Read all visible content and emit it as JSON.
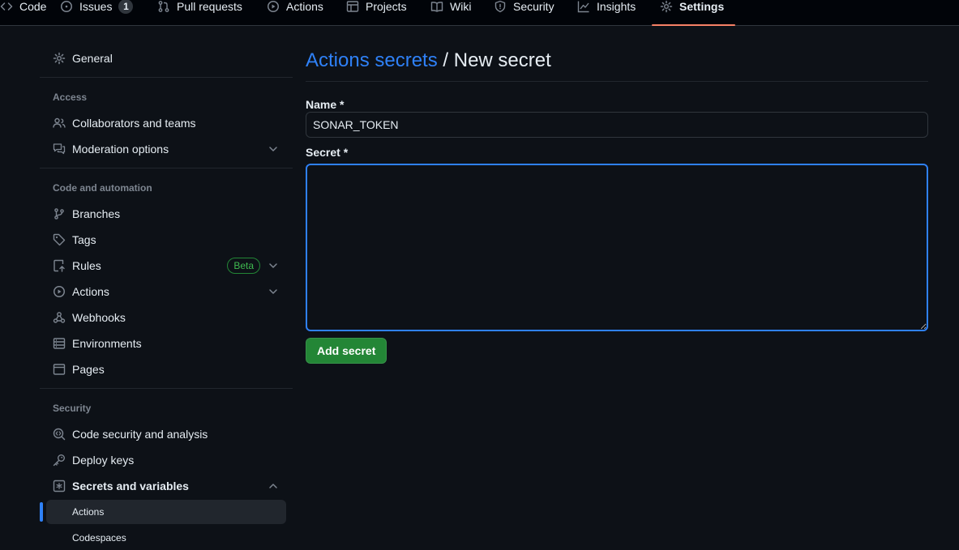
{
  "repo_nav": {
    "tabs": [
      {
        "label": "Code",
        "icon": "code-icon"
      },
      {
        "label": "Issues",
        "icon": "issue-opened-icon",
        "counter": "1"
      },
      {
        "label": "Pull requests",
        "icon": "git-pull-request-icon"
      },
      {
        "label": "Actions",
        "icon": "play-icon"
      },
      {
        "label": "Projects",
        "icon": "table-icon"
      },
      {
        "label": "Wiki",
        "icon": "book-icon"
      },
      {
        "label": "Security",
        "icon": "shield-icon"
      },
      {
        "label": "Insights",
        "icon": "graph-icon"
      },
      {
        "label": "Settings",
        "icon": "gear-icon",
        "selected": true
      }
    ],
    "selected_underline_color": "#f78166"
  },
  "sidebar": {
    "general": "General",
    "access_heading": "Access",
    "collaborators": "Collaborators and teams",
    "moderation": "Moderation options",
    "code_automation_heading": "Code and automation",
    "branches": "Branches",
    "tags": "Tags",
    "rules": "Rules",
    "rules_badge": "Beta",
    "actions": "Actions",
    "webhooks": "Webhooks",
    "environments": "Environments",
    "pages": "Pages",
    "security_heading": "Security",
    "code_security": "Code security and analysis",
    "deploy_keys": "Deploy keys",
    "secrets_variables": "Secrets and variables",
    "sub_actions": "Actions",
    "sub_codespaces": "Codespaces"
  },
  "main": {
    "breadcrumb_link": "Actions secrets",
    "breadcrumb_separator": " / ",
    "title": "New secret",
    "name_label": "Name *",
    "name_value": "SONAR_TOKEN",
    "secret_label": "Secret *",
    "secret_value": "",
    "submit_label": "Add secret"
  },
  "colors": {
    "background": "#0d1117",
    "accent_blue": "#2f81f7",
    "primary_button": "#238636",
    "beta_badge": "#3fb950"
  }
}
